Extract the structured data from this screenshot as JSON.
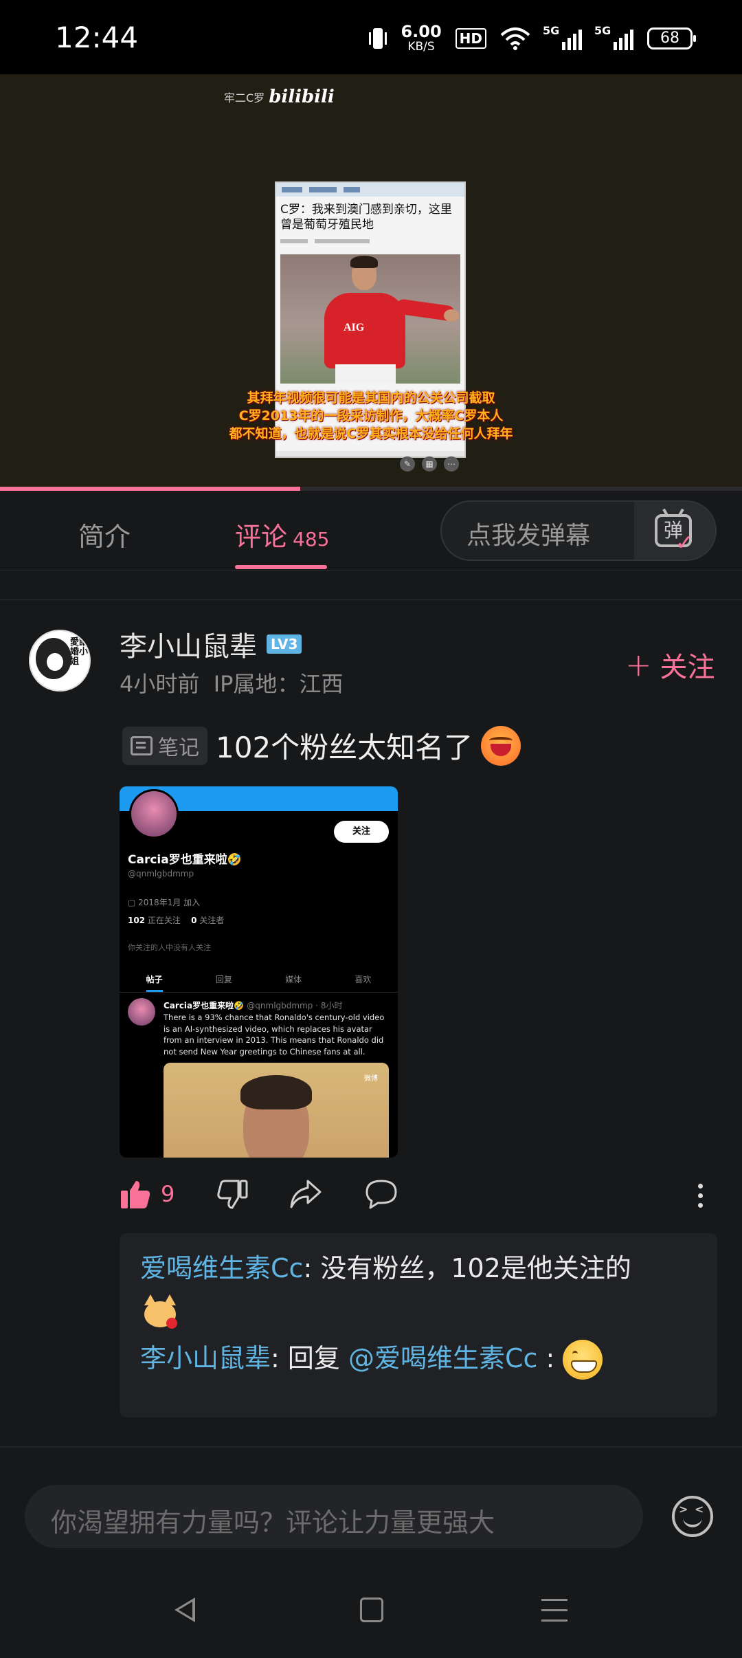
{
  "status_bar": {
    "time": "12:44",
    "net_speed": "6.00",
    "net_unit": "KB/S",
    "hd_label": "HD",
    "signal1_label": "5G",
    "signal2_label": "5G",
    "battery": "68"
  },
  "video": {
    "watermark_cn": "牢二C罗",
    "watermark_brand": "bilibili",
    "news_title": "C罗：我来到澳门感到亲切，这里曾是葡萄牙殖民地",
    "jersey_sponsor": "AIG",
    "subtitle_lines": [
      "其拜年视频很可能是其国内的公关公司截取",
      "C罗2013年的一段采访制作，大概率C罗本人",
      "都不知道，也就是说C罗其实根本没给任何人拜年"
    ],
    "progress_fraction": 0.405
  },
  "tabs": {
    "intro": "简介",
    "comments": "评论",
    "comments_count": "485",
    "danmaku_placeholder": "点我发弹幕",
    "danmaku_icon_char": "弹"
  },
  "comment": {
    "username": "李小山鼠辈",
    "level": "LV3",
    "time": "4小时前",
    "ip": "IP属地：江西",
    "follow_label": "关注",
    "note_tag": "笔记",
    "text": "102个粉丝太知名了",
    "avatar_text": "愛誰婚小姐",
    "likes": "9",
    "embedded_screenshot": {
      "follow_btn": "关注",
      "display_name": "Carcia罗也重来啦🤣",
      "handle": "@qnmlgbdmmp",
      "joined": "2018年1月 加入",
      "following_count": "102",
      "following_label": "正在关注",
      "followers_count": "0",
      "followers_label": "关注者",
      "no_followers_note": "你关注的人中没有人关注",
      "tabs": [
        "帖子",
        "回复",
        "媒体",
        "喜欢"
      ],
      "post_name": "Carcia罗也重来啦🤣",
      "post_meta": "@qnmlgbdmmp · 8小时",
      "post_text": "There is a 93% chance that Ronaldo's century-old video is an AI-synthesized video, which replaces his avatar from an interview in 2013. This means that Ronaldo did not send New Year greetings to Chinese fans at all.",
      "post_image_logo": "微博"
    }
  },
  "replies": [
    {
      "user": "爱喝维生素Cc",
      "separator": ": ",
      "text": "没有粉丝，102是他关注的"
    },
    {
      "user": "李小山鼠辈",
      "separator": ": ",
      "text": "回复 ",
      "mention": "@爱喝维生素Cc",
      "after_mention": " :"
    }
  ],
  "input": {
    "placeholder": "你渴望拥有力量吗？评论让力量更强大"
  },
  "colors": {
    "accent": "#fb7299",
    "link": "#5fb4e3",
    "background": "#17181a"
  }
}
